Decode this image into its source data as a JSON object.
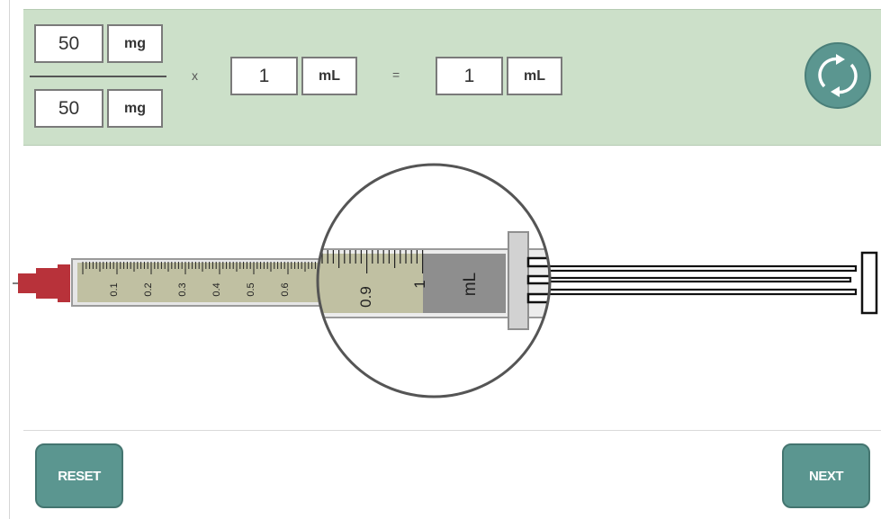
{
  "calculator": {
    "numerator": {
      "value": "50",
      "unit": "mg"
    },
    "denominator": {
      "value": "50",
      "unit": "mg"
    },
    "multiply_symbol": "x",
    "volume": {
      "value": "1",
      "unit": "mL"
    },
    "equals_symbol": "=",
    "result": {
      "value": "1",
      "unit": "mL"
    }
  },
  "syringe": {
    "scale_labels": [
      "0.1",
      "0.2",
      "0.3",
      "0.4",
      "0.5",
      "0.6"
    ],
    "magnified_labels": [
      "0.9",
      "1"
    ],
    "unit_label": "mL",
    "fill_level_ml": 1.0,
    "capacity_ml": 1.0
  },
  "buttons": {
    "reset": "RESET",
    "next": "NEXT"
  },
  "colors": {
    "panel": "#cce0c9",
    "button": "#5b9690",
    "liquid": "#c0c0a2",
    "needle_cap": "#b8323a",
    "stopper": "#8e8e8e"
  },
  "icons": {
    "refresh": "refresh-icon"
  }
}
